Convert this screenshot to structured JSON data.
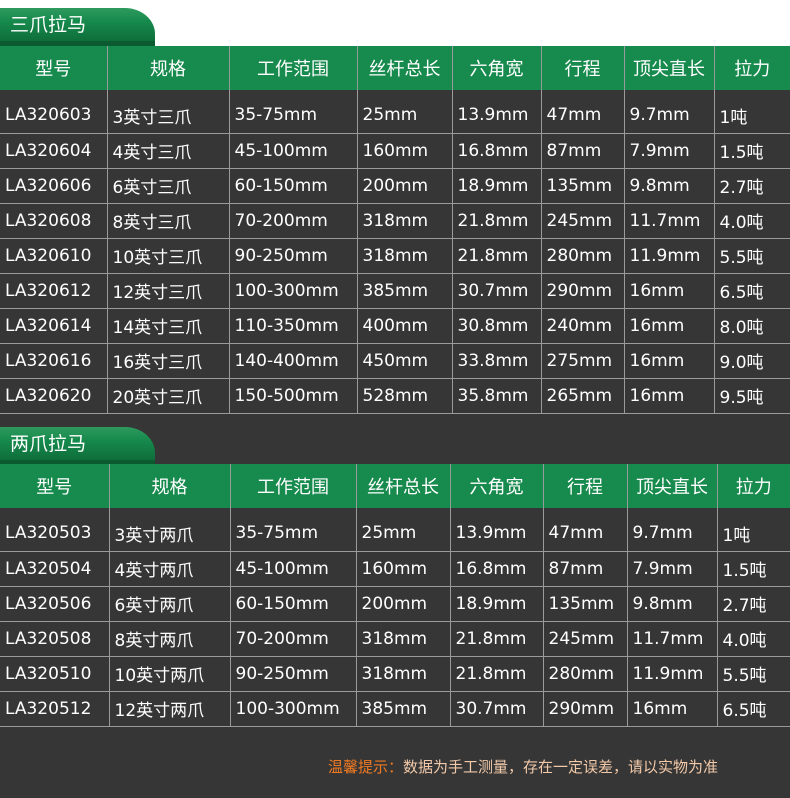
{
  "colors": {
    "header_green": "#178a4d",
    "background": "#363636",
    "note_highlight": "#f07a22"
  },
  "columns": [
    "型号",
    "规格",
    "工作范围",
    "丝杆总长",
    "六角宽",
    "行程",
    "顶尖直长",
    "拉力"
  ],
  "sections": [
    {
      "title": "三爪拉马",
      "rows": [
        [
          "LA320603",
          "3英寸三爪",
          "35-75mm",
          "25mm",
          "13.9mm",
          "47mm",
          "9.7mm",
          "1吨"
        ],
        [
          "LA320604",
          "4英寸三爪",
          "45-100mm",
          "160mm",
          "16.8mm",
          "87mm",
          "7.9mm",
          "1.5吨"
        ],
        [
          "LA320606",
          "6英寸三爪",
          "60-150mm",
          "200mm",
          "18.9mm",
          "135mm",
          "9.8mm",
          "2.7吨"
        ],
        [
          "LA320608",
          "8英寸三爪",
          "70-200mm",
          "318mm",
          "21.8mm",
          "245mm",
          "11.7mm",
          "4.0吨"
        ],
        [
          "LA320610",
          "10英寸三爪",
          "90-250mm",
          "318mm",
          "21.8mm",
          "280mm",
          "11.9mm",
          "5.5吨"
        ],
        [
          "LA320612",
          "12英寸三爪",
          "100-300mm",
          "385mm",
          "30.7mm",
          "290mm",
          "16mm",
          "6.5吨"
        ],
        [
          "LA320614",
          "14英寸三爪",
          "110-350mm",
          "400mm",
          "30.8mm",
          "240mm",
          "16mm",
          "8.0吨"
        ],
        [
          "LA320616",
          "16英寸三爪",
          "140-400mm",
          "450mm",
          "33.8mm",
          "275mm",
          "16mm",
          "9.0吨"
        ],
        [
          "LA320620",
          "20英寸三爪",
          "150-500mm",
          "528mm",
          "35.8mm",
          "265mm",
          "16mm",
          "9.5吨"
        ]
      ]
    },
    {
      "title": "两爪拉马",
      "rows": [
        [
          "LA320503",
          "3英寸两爪",
          "35-75mm",
          "25mm",
          "13.9mm",
          "47mm",
          "9.7mm",
          "1吨"
        ],
        [
          "LA320504",
          "4英寸两爪",
          "45-100mm",
          "160mm",
          "16.8mm",
          "87mm",
          "7.9mm",
          "1.5吨"
        ],
        [
          "LA320506",
          "6英寸两爪",
          "60-150mm",
          "200mm",
          "18.9mm",
          "135mm",
          "9.8mm",
          "2.7吨"
        ],
        [
          "LA320508",
          "8英寸两爪",
          "70-200mm",
          "318mm",
          "21.8mm",
          "245mm",
          "11.7mm",
          "4.0吨"
        ],
        [
          "LA320510",
          "10英寸两爪",
          "90-250mm",
          "318mm",
          "21.8mm",
          "280mm",
          "11.9mm",
          "5.5吨"
        ],
        [
          "LA320512",
          "12英寸两爪",
          "100-300mm",
          "385mm",
          "30.7mm",
          "290mm",
          "16mm",
          "6.5吨"
        ]
      ]
    }
  ],
  "note": {
    "label": "温馨提示：",
    "text": "数据为手工测量，存在一定误差，请以实物为准"
  }
}
